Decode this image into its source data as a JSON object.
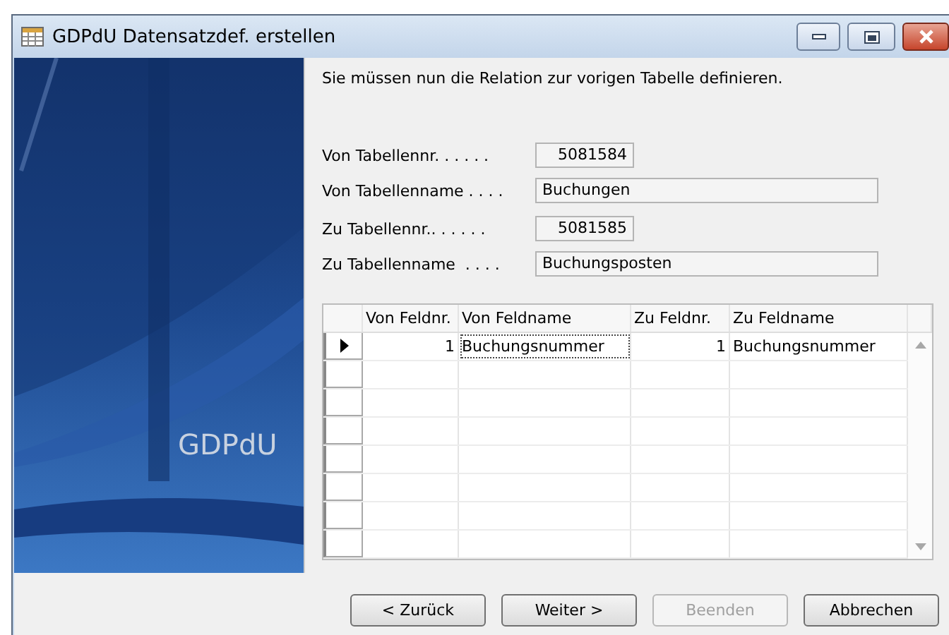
{
  "window": {
    "title": "GDPdU Datensatzdef. erstellen"
  },
  "banner": {
    "text": "GDPdU"
  },
  "instruction": "Sie müssen nun die Relation zur vorigen Tabelle definieren.",
  "fields": [
    {
      "label": "Von Tabellennr. . . . . .",
      "value": "5081584",
      "kind": "number"
    },
    {
      "label": "Von Tabellenname . . . .",
      "value": "Buchungen",
      "kind": "text"
    },
    {
      "label": "Zu Tabellennr.. . . . . .",
      "value": "5081585",
      "kind": "number"
    },
    {
      "label": "Zu Tabellenname  . . . .",
      "value": "Buchungsposten",
      "kind": "text"
    }
  ],
  "table": {
    "columns": [
      "Von Feldnr.",
      "Von Feldname",
      "Zu Feldnr.",
      "Zu Feldname"
    ],
    "rows": [
      {
        "selected": true,
        "cells": [
          {
            "text": "1",
            "focused": false
          },
          {
            "text": "Buchungsnummer",
            "focused": true
          },
          {
            "text": "1",
            "focused": false
          },
          {
            "text": "Buchungsnummer",
            "focused": false
          }
        ]
      }
    ]
  },
  "buttons": [
    {
      "label": "< Zurück",
      "disabled": false
    },
    {
      "label": "Weiter >",
      "disabled": false
    },
    {
      "label": "Beenden",
      "disabled": true
    },
    {
      "label": "Abbrechen",
      "disabled": false
    }
  ]
}
